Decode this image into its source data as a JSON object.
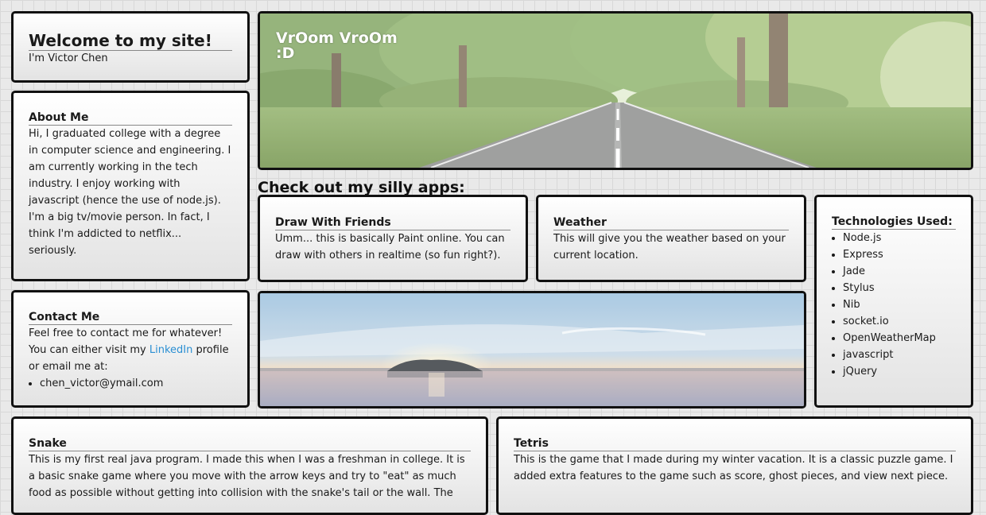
{
  "welcome": {
    "title": "Welcome to my site!",
    "subtitle": "I'm Victor Chen"
  },
  "about": {
    "heading": "About Me",
    "text": "Hi, I graduated college with a degree in computer science and engineering. I am currently working in the tech industry. I enjoy working with javascript (hence the use of node.js). I'm a big tv/movie person. In fact, I think I'm addicted to netflix... seriously."
  },
  "contact": {
    "heading": "Contact Me",
    "text_before": "Feel free to contact me for whatever! You can either visit my",
    "link": "LinkedIn",
    "text_after": "profile or email me at:",
    "email": "chen_victor@ymail.com"
  },
  "banner": {
    "title_line1": "VrOom VroOm",
    "title_line2": ":D"
  },
  "apps_heading": "Check out my silly apps:",
  "apps": [
    {
      "title": "Draw With Friends",
      "description": "Umm... this is basically Paint online. You can draw with others in realtime (so fun right?)."
    },
    {
      "title": "Weather",
      "description": "This will give you the weather based on your current location."
    },
    {
      "title": "Snake",
      "description": "This is my first real java program. I made this when I was a freshman in college. It is a basic snake game where you move with the arrow keys and try to \"eat\" as much food as possible without getting into collision with the snake's tail or the wall. The"
    },
    {
      "title": "Tetris",
      "description": "This is the game that I made during my winter vacation. It is a classic puzzle game. I added extra features to the game such as score, ghost pieces, and view next piece."
    }
  ],
  "technologies": {
    "heading": "Technologies Used:",
    "items": [
      "Node.js",
      "Express",
      "Jade",
      "Stylus",
      "Nib",
      "socket.io",
      "OpenWeatherMap",
      "javascript",
      "jQuery"
    ]
  },
  "colors": {
    "link": "#2a8fd3",
    "card_border": "#111111",
    "page_background": "#e9e9e9"
  }
}
